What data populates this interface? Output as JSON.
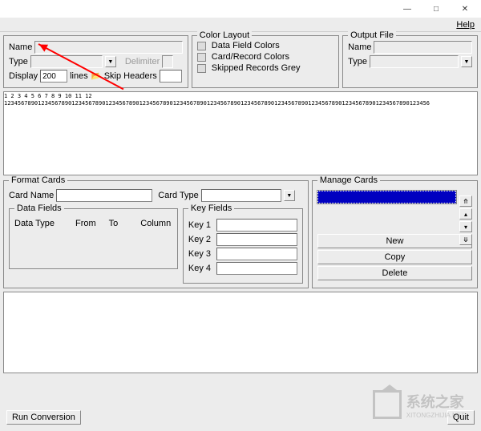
{
  "window": {
    "minimize": "—",
    "maximize": "□",
    "close": "✕"
  },
  "menu": {
    "help": "Help"
  },
  "sourcePanel": {
    "name_label": "Name",
    "type_label": "Type",
    "display_label": "Display",
    "display_value": "200",
    "lines_label": "lines",
    "delimiter_label": "Delimiter",
    "skip_headers_label": "Skip Headers"
  },
  "colorPanel": {
    "title": "Color Layout",
    "opt1": "Data Field Colors",
    "opt2": "Card/Record Colors",
    "opt3": "Skipped Records Grey"
  },
  "outputPanel": {
    "title": "Output File",
    "name_label": "Name",
    "type_label": "Type"
  },
  "ruler": {
    "tens": "         1         2         3         4         5         6         7         8         9         10        11        12",
    "units": "123456789012345678901234567890123456789012345678901234567890123456789012345678901234567890123456789012345678901234567890123456"
  },
  "formatCards": {
    "title": "Format Cards",
    "card_name": "Card Name",
    "card_type": "Card Type",
    "data_fields_title": "Data Fields",
    "col_type": "Data Type",
    "col_from": "From",
    "col_to": "To",
    "col_column": "Column",
    "key_fields_title": "Key Fields",
    "key1": "Key 1",
    "key2": "Key 2",
    "key3": "Key 3",
    "key4": "Key 4"
  },
  "manageCards": {
    "title": "Manage Cards",
    "new": "New",
    "copy": "Copy",
    "delete": "Delete"
  },
  "footer": {
    "run": "Run Conversion",
    "quit": "Quit"
  },
  "watermark": {
    "brand": "系统之家",
    "url": "XITONGZHIJIA.NET"
  }
}
